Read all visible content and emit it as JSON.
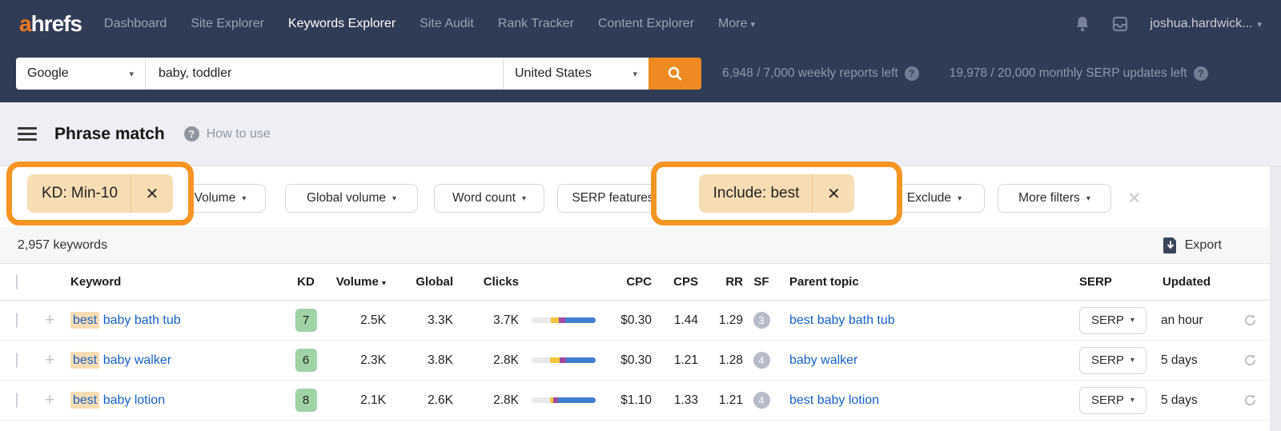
{
  "icons": {
    "caret": "▾",
    "close": "✕",
    "clear": "✕",
    "plus": "+",
    "question": "?"
  },
  "colors": {
    "accent_orange": "#f49523",
    "navbar": "#303c55",
    "link_blue": "#1760c9",
    "kd_green": "#9fd3a6",
    "chip_tan": "#f7ddb3"
  },
  "navbar": {
    "logo_a": "a",
    "logo_rest": "hrefs",
    "items": [
      {
        "label": "Dashboard"
      },
      {
        "label": "Site Explorer"
      },
      {
        "label": "Keywords Explorer"
      },
      {
        "label": "Site Audit"
      },
      {
        "label": "Rank Tracker"
      },
      {
        "label": "Content Explorer"
      },
      {
        "label": "More"
      }
    ],
    "user": "joshua.hardwick..."
  },
  "search": {
    "engine": "Google",
    "query": "baby, toddler",
    "country": "United States",
    "quota_weekly": "6,948 / 7,000 weekly reports left",
    "quota_serp": "19,978 / 20,000 monthly SERP updates left"
  },
  "header": {
    "title": "Phrase match",
    "help": "How to use"
  },
  "filters": {
    "kd_chip": "KD: Min-10",
    "volume": "Volume",
    "global_volume": "Global volume",
    "word_count": "Word count",
    "serp_features": "SERP features",
    "include_chip": "Include: best",
    "exclude": "Exclude",
    "more_filters": "More filters"
  },
  "results": {
    "count": "2,957 keywords",
    "export": "Export"
  },
  "table": {
    "columns": [
      "Keyword",
      "KD",
      "Volume",
      "Global",
      "Clicks",
      "CPC",
      "CPS",
      "RR",
      "SF",
      "Parent topic",
      "SERP",
      "Updated"
    ],
    "rows": [
      {
        "kw_hl": "best",
        "kw_rest": " baby bath tub",
        "kd": "7",
        "volume": "2.5K",
        "global": "3.3K",
        "clicks": "3.7K",
        "bar": {
          "grey": 30,
          "yellow": 13,
          "purple": 9,
          "blue": 48
        },
        "cpc": "$0.30",
        "cps": "1.44",
        "rr": "1.29",
        "sf": "3",
        "parent": "best baby bath tub",
        "serp": "SERP",
        "updated": "an hour"
      },
      {
        "kw_hl": "best",
        "kw_rest": " baby walker",
        "kd": "6",
        "volume": "2.3K",
        "global": "3.8K",
        "clicks": "2.8K",
        "bar": {
          "grey": 29,
          "yellow": 15,
          "purple": 10,
          "blue": 46
        },
        "cpc": "$0.30",
        "cps": "1.21",
        "rr": "1.28",
        "sf": "4",
        "parent": "baby walker",
        "serp": "SERP",
        "updated": "5 days"
      },
      {
        "kw_hl": "best",
        "kw_rest": " baby lotion",
        "kd": "8",
        "volume": "2.1K",
        "global": "2.6K",
        "clicks": "2.8K",
        "bar": {
          "grey": 29,
          "yellow": 5,
          "purple": 7,
          "blue": 59
        },
        "cpc": "$1.10",
        "cps": "1.33",
        "rr": "1.21",
        "sf": "4",
        "parent": "best baby lotion",
        "serp": "SERP",
        "updated": "5 days"
      }
    ]
  }
}
